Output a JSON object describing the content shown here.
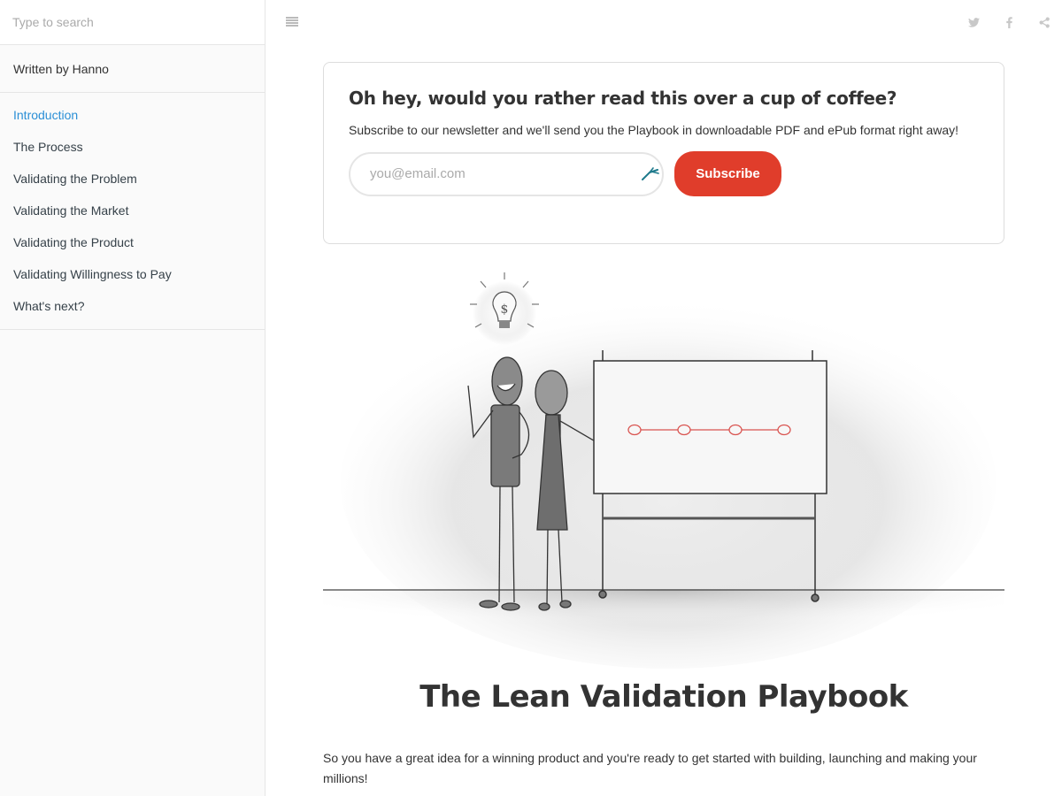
{
  "sidebar": {
    "search_placeholder": "Type to search",
    "author": "Written by Hanno",
    "toc": [
      {
        "label": "Introduction",
        "active": true
      },
      {
        "label": "The Process",
        "active": false
      },
      {
        "label": "Validating the Problem",
        "active": false
      },
      {
        "label": "Validating the Market",
        "active": false
      },
      {
        "label": "Validating the Product",
        "active": false
      },
      {
        "label": "Validating Willingness to Pay",
        "active": false
      },
      {
        "label": "What's next?",
        "active": false
      }
    ]
  },
  "header": {
    "menu_icon": "hamburger-icon",
    "social": [
      "twitter-icon",
      "facebook-icon",
      "share-icon"
    ]
  },
  "newsletter": {
    "heading": "Oh hey, would you rather read this over a cup of coffee?",
    "description": "Subscribe to our newsletter and we'll send you the Playbook in downloadable PDF and ePub format right away!",
    "email_placeholder": "you@email.com",
    "email_value": "",
    "subscribe_label": "Subscribe"
  },
  "illustration": {
    "description": "Pencil sketch of two stick figures presenting a whiteboard with a dollar-sign lightbulb above one figure",
    "bulb_symbol": "$",
    "timeline_nodes": 4
  },
  "article": {
    "title": "The Lean Validation Playbook",
    "intro": "So you have a great idea for a winning product and you're ready to get started with building, launching and making your millions!"
  },
  "colors": {
    "accent_link": "#2b8fd6",
    "subscribe_button": "#e03d2b",
    "timeline_red": "#d9534f"
  }
}
